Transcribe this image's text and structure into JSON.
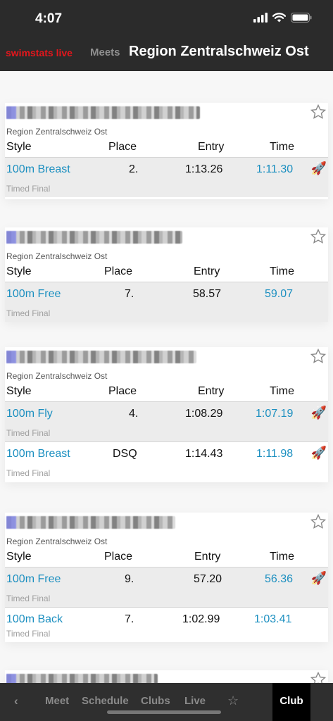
{
  "status": {
    "time": "4:07"
  },
  "header": {
    "brand": "swimstats live",
    "meets": "Meets",
    "title": "Region Zentralschweiz Ost"
  },
  "columns": {
    "style": "Style",
    "place": "Place",
    "entry": "Entry",
    "time": "Time"
  },
  "cards": [
    {
      "meet": "Region Zentralschweiz Ost",
      "results": [
        {
          "style": "100m Breast",
          "place": "2.",
          "entry": "1:13.26",
          "time": "1:11.30",
          "type": "Timed Final",
          "rocket": "🚀"
        }
      ]
    },
    {
      "meet": "Region Zentralschweiz Ost",
      "results": [
        {
          "style": "100m Free",
          "place": "7.",
          "entry": "58.57",
          "time": "59.07",
          "type": "Timed Final"
        }
      ]
    },
    {
      "meet": "Region Zentralschweiz Ost",
      "results": [
        {
          "style": "100m Fly",
          "place": "4.",
          "entry": "1:08.29",
          "time": "1:07.19",
          "type": "Timed Final",
          "rocket": "🚀"
        },
        {
          "style": "100m Breast",
          "place": "DSQ",
          "entry": "1:14.43",
          "time": "1:11.98",
          "type": "Timed Final",
          "rocket": "🚀"
        }
      ]
    },
    {
      "meet": "Region Zentralschweiz Ost",
      "results": [
        {
          "style": "100m Free",
          "place": "9.",
          "entry": "57.20",
          "time": "56.36",
          "type": "Timed Final",
          "rocket": "🚀"
        },
        {
          "style": "100m Back",
          "place": "7.",
          "entry": "1:02.99",
          "time": "1:03.41",
          "type": "Timed Final"
        }
      ]
    }
  ],
  "tabbar": {
    "back": "‹",
    "meet": "Meet",
    "schedule": "Schedule",
    "clubs": "Clubs",
    "live": "Live",
    "fav": "☆",
    "club": "Club"
  },
  "colors": {
    "brand": "#e5161c",
    "accent": "#1b8fc0",
    "bar": "#2b2b2b"
  }
}
